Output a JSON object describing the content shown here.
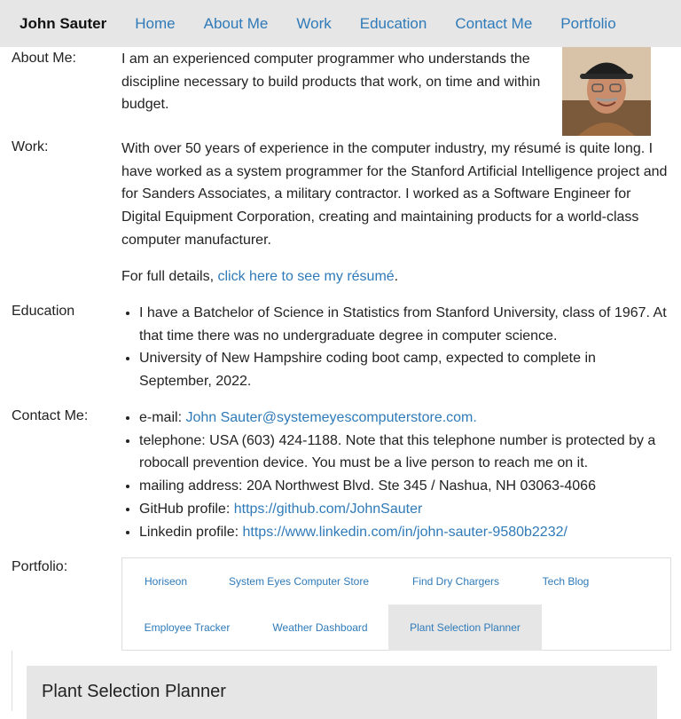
{
  "nav": {
    "brand": "John Sauter",
    "links": [
      "Home",
      "About Me",
      "Work",
      "Education",
      "Contact Me",
      "Portfolio"
    ]
  },
  "about": {
    "label": "About Me:",
    "text": "I am an experienced computer programmer who understands the discipline necessary to build products that work, on time and within budget."
  },
  "work": {
    "label": "Work:",
    "text": "With over 50 years of experience in the computer industry, my résumé is quite long. I have worked as a system programmer for the Stanford Artificial Intelligence project and for Sanders Associates, a military contractor. I worked as a Software Engineer for Digital Equipment Corporation, creating and maintaining products for a world-class computer manufacturer.",
    "details_prefix": "For full details, ",
    "details_link": "click here to see my résumé",
    "details_suffix": "."
  },
  "education": {
    "label": "Education",
    "items": [
      "I have a Batchelor of Science in Statistics from Stanford University, class of 1967. At that time there was no undergraduate degree in computer science.",
      "University of New Hampshire coding boot camp, expected to complete in September, 2022."
    ]
  },
  "contact": {
    "label": "Contact Me:",
    "email_prefix": "e-mail: ",
    "email_link": "John Sauter@systemeyescomputerstore.com.",
    "telephone": "telephone: USA (603) 424-1188. Note that this telephone number is protected by a robocall prevention device. You must be a live person to reach me on it.",
    "mailing": "mailing address: 20A Northwest Blvd. Ste 345 / Nashua, NH 03063-4066",
    "github_prefix": "GitHub profile: ",
    "github_link": "https://github.com/JohnSauter",
    "linkedin_prefix": "Linkedin profile: ",
    "linkedin_link": "https://www.linkedin.com/in/john-sauter-9580b2232/"
  },
  "portfolio": {
    "label": "Portfolio:",
    "tabs": [
      "Horiseon",
      "System Eyes Computer Store",
      "Find Dry Chargers",
      "Tech Blog",
      "Employee Tracker",
      "Weather Dashboard",
      "Plant Selection Planner"
    ],
    "active_tab": "Plant Selection Planner",
    "panel_title": "Plant Selection Planner"
  }
}
